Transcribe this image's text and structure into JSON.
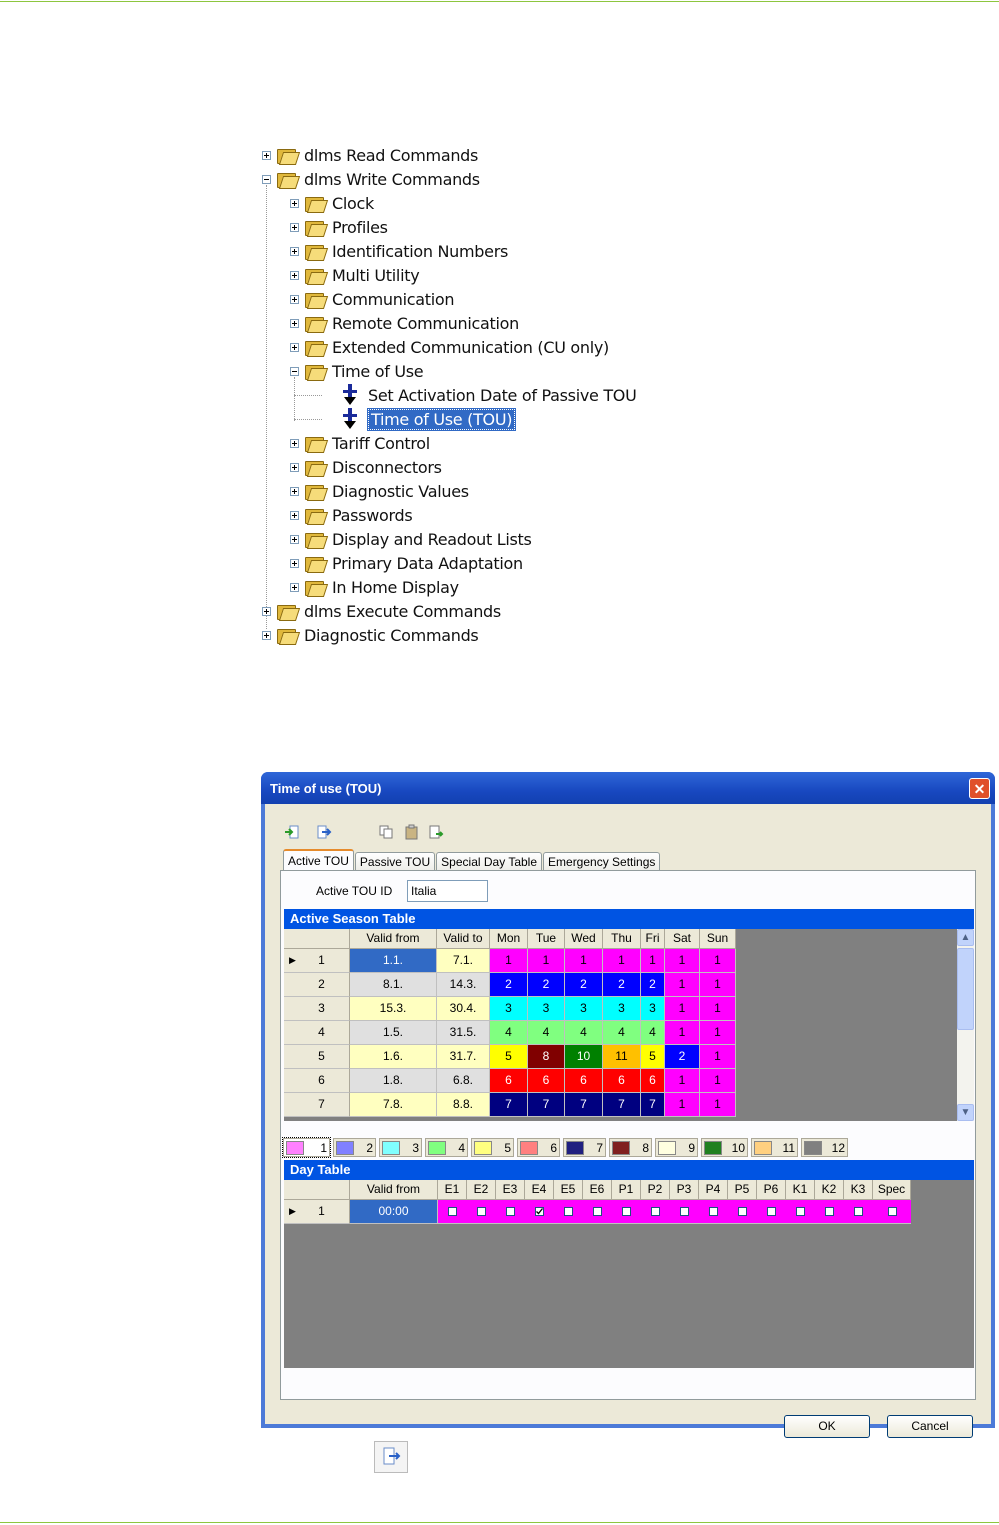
{
  "tree": {
    "items": [
      {
        "label": "dlms Read Commands",
        "expander": "plus",
        "indent": 0,
        "icon": "folder-icon"
      },
      {
        "label": "dlms Write Commands",
        "expander": "minus",
        "indent": 0,
        "icon": "folder-icon"
      },
      {
        "label": "Clock",
        "expander": "plus",
        "indent": 1,
        "icon": "folder-icon"
      },
      {
        "label": "Profiles",
        "expander": "plus",
        "indent": 1,
        "icon": "folder-icon"
      },
      {
        "label": "Identification Numbers",
        "expander": "plus",
        "indent": 1,
        "icon": "folder-icon"
      },
      {
        "label": "Multi Utility",
        "expander": "plus",
        "indent": 1,
        "icon": "folder-icon"
      },
      {
        "label": "Communication",
        "expander": "plus",
        "indent": 1,
        "icon": "folder-icon"
      },
      {
        "label": "Remote Communication",
        "expander": "plus",
        "indent": 1,
        "icon": "folder-icon"
      },
      {
        "label": "Extended Communication (CU only)",
        "expander": "plus",
        "indent": 1,
        "icon": "folder-icon"
      },
      {
        "label": "Time of Use",
        "expander": "minus",
        "indent": 1,
        "icon": "folder-icon"
      },
      {
        "label": "Set Activation Date of Passive TOU",
        "expander": "none",
        "indent": 2,
        "icon": "write-command-icon"
      },
      {
        "label": "Time of Use (TOU)",
        "expander": "none",
        "indent": 2,
        "icon": "write-command-icon",
        "selected": true
      },
      {
        "label": "Tariff Control",
        "expander": "plus",
        "indent": 1,
        "icon": "folder-icon"
      },
      {
        "label": "Disconnectors",
        "expander": "plus",
        "indent": 1,
        "icon": "folder-icon"
      },
      {
        "label": "Diagnostic Values",
        "expander": "plus",
        "indent": 1,
        "icon": "folder-icon"
      },
      {
        "label": "Passwords",
        "expander": "plus",
        "indent": 1,
        "icon": "folder-icon"
      },
      {
        "label": "Display and Readout Lists",
        "expander": "plus",
        "indent": 1,
        "icon": "folder-icon"
      },
      {
        "label": "Primary Data Adaptation",
        "expander": "plus",
        "indent": 1,
        "icon": "folder-icon"
      },
      {
        "label": "In Home Display",
        "expander": "plus",
        "indent": 1,
        "icon": "folder-icon"
      },
      {
        "label": "dlms Execute Commands",
        "expander": "plus",
        "indent": 0,
        "icon": "folder-icon"
      },
      {
        "label": "Diagnostic Commands",
        "expander": "plus",
        "indent": 0,
        "icon": "folder-icon"
      }
    ]
  },
  "dialog": {
    "title": "Time of use (TOU)",
    "close_glyph": "✕",
    "toolbar": [
      "import-icon",
      "export-icon",
      "copy-icon",
      "paste-icon",
      "paste-special-icon"
    ],
    "tabs": [
      "Active TOU",
      "Passive TOU",
      "Special Day Table",
      "Emergency Settings"
    ],
    "active_tab": "Active TOU",
    "tou_id_label": "Active TOU ID",
    "tou_id_value": "Italia",
    "season_table": {
      "title": "Active Season Table",
      "columns": [
        "Valid from",
        "Valid to",
        "Mon",
        "Tue",
        "Wed",
        "Thu",
        "Fri",
        "Sat",
        "Sun"
      ],
      "rows": [
        {
          "n": "1",
          "from": "1.1.",
          "to": "7.1.",
          "days": [
            "1",
            "1",
            "1",
            "1",
            "1",
            "1",
            "1"
          ],
          "current": true
        },
        {
          "n": "2",
          "from": "8.1.",
          "to": "14.3.",
          "days": [
            "2",
            "2",
            "2",
            "2",
            "2",
            "1",
            "1"
          ]
        },
        {
          "n": "3",
          "from": "15.3.",
          "to": "30.4.",
          "days": [
            "3",
            "3",
            "3",
            "3",
            "3",
            "1",
            "1"
          ]
        },
        {
          "n": "4",
          "from": "1.5.",
          "to": "31.5.",
          "days": [
            "4",
            "4",
            "4",
            "4",
            "4",
            "1",
            "1"
          ]
        },
        {
          "n": "5",
          "from": "1.6.",
          "to": "31.7.",
          "days": [
            "5",
            "8",
            "10",
            "11",
            "5",
            "2",
            "1"
          ]
        },
        {
          "n": "6",
          "from": "1.8.",
          "to": "6.8.",
          "days": [
            "6",
            "6",
            "6",
            "6",
            "6",
            "1",
            "1"
          ]
        },
        {
          "n": "7",
          "from": "7.8.",
          "to": "8.8.",
          "days": [
            "7",
            "7",
            "7",
            "7",
            "7",
            "1",
            "1"
          ]
        }
      ]
    },
    "day_profiles": [
      {
        "label": "1",
        "color": "#ff80ff"
      },
      {
        "label": "2",
        "color": "#8080ff"
      },
      {
        "label": "3",
        "color": "#80ffff"
      },
      {
        "label": "4",
        "color": "#80ff80"
      },
      {
        "label": "5",
        "color": "#ffff80"
      },
      {
        "label": "6",
        "color": "#ff8080"
      },
      {
        "label": "7",
        "color": "#202080"
      },
      {
        "label": "8",
        "color": "#802020"
      },
      {
        "label": "9",
        "color": "#ffffe0"
      },
      {
        "label": "10",
        "color": "#208020"
      },
      {
        "label": "11",
        "color": "#ffd080"
      },
      {
        "label": "12",
        "color": "#808080"
      }
    ],
    "selected_day_profile": "1",
    "day_table": {
      "title": "Day Table",
      "columns": [
        "Valid from",
        "E1",
        "E2",
        "E3",
        "E4",
        "E5",
        "E6",
        "P1",
        "P2",
        "P3",
        "P4",
        "P5",
        "P6",
        "K1",
        "K2",
        "K3",
        "Spec"
      ],
      "rows": [
        {
          "n": "1",
          "from": "00:00",
          "checked": [
            false,
            false,
            false,
            true,
            false,
            false,
            false,
            false,
            false,
            false,
            false,
            false,
            false,
            false,
            false,
            false
          ]
        }
      ]
    },
    "ok_label": "OK",
    "cancel_label": "Cancel"
  },
  "caption_icon": "export-icon",
  "colors": {
    "day1": "#ff00ff",
    "day2": "#0000ff",
    "day3": "#00ffff",
    "day4": "#80ff80",
    "day5": "#ffff00",
    "day6": "#ff0000",
    "day7": "#000080",
    "day8": "#800000",
    "day10": "#008000",
    "day11": "#ffc000",
    "selection": "#316ac5",
    "title_blue": "#0054e3",
    "accent_green": "#8dc63f"
  }
}
